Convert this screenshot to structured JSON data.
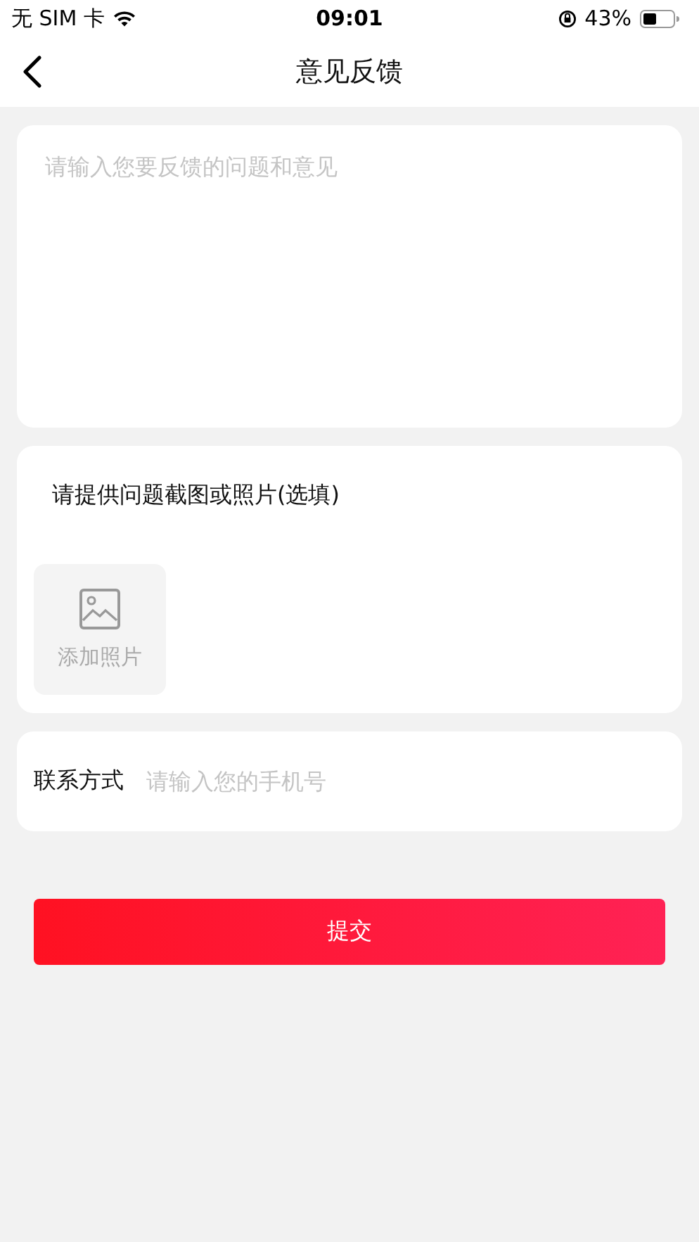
{
  "status_bar": {
    "carrier": "无 SIM 卡",
    "time": "09:01",
    "battery": "43%"
  },
  "nav": {
    "title": "意见反馈"
  },
  "feedback": {
    "placeholder": "请输入您要反馈的问题和意见"
  },
  "photos": {
    "label": "请提供问题截图或照片(选填)",
    "add_label": "添加照片"
  },
  "contact": {
    "label": "联系方式",
    "placeholder": "请输入您的手机号"
  },
  "submit": "提交"
}
